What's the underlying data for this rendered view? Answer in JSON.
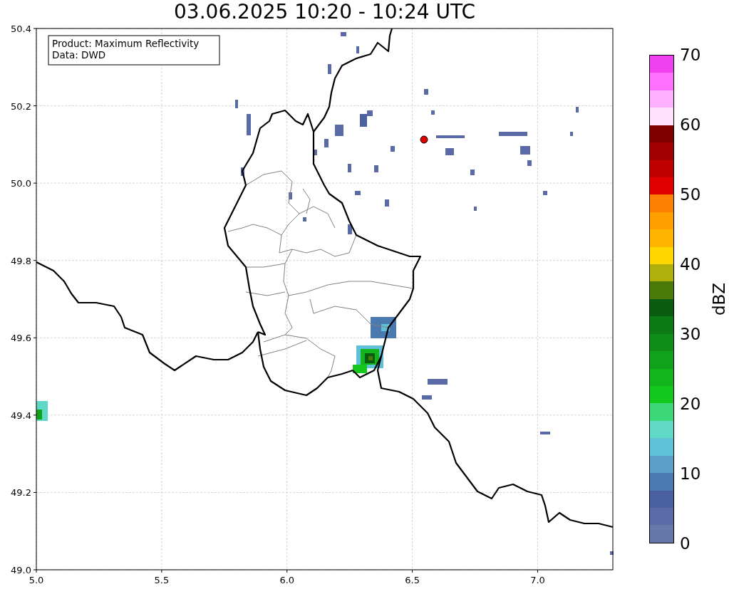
{
  "title": "03.06.2025 10:20 - 10:24 UTC",
  "map": {
    "info_lines": [
      "Product: Maximum Reflectivity",
      "Data: DWD"
    ],
    "xticks": [
      "5.0",
      "5.5",
      "6.0",
      "6.5",
      "7.0"
    ],
    "yticks": [
      "50.4",
      "50.2",
      "50.0",
      "49.8",
      "49.6",
      "49.4",
      "49.2",
      "49.0"
    ]
  },
  "colorbar": {
    "label": "dBZ",
    "ticks": [
      "70",
      "60",
      "50",
      "40",
      "30",
      "20",
      "10",
      "0"
    ],
    "bands": [
      {
        "color": "#6677aa"
      },
      {
        "color": "#5a6aa6"
      },
      {
        "color": "#4a60a0"
      },
      {
        "color": "#4a7ab0"
      },
      {
        "color": "#5aa0c8"
      },
      {
        "color": "#60c0d8"
      },
      {
        "color": "#60d8c8"
      },
      {
        "color": "#3cd878"
      },
      {
        "color": "#14c81e"
      },
      {
        "color": "#12b61c"
      },
      {
        "color": "#10a21a"
      },
      {
        "color": "#0e8e17"
      },
      {
        "color": "#0c7a15"
      },
      {
        "color": "#0a5a10"
      },
      {
        "color": "#4a7a0a"
      },
      {
        "color": "#b0b00a"
      },
      {
        "color": "#ffd700"
      },
      {
        "color": "#ffb400"
      },
      {
        "color": "#ffa000"
      },
      {
        "color": "#ff8000"
      },
      {
        "color": "#e00000"
      },
      {
        "color": "#c00000"
      },
      {
        "color": "#a00000"
      },
      {
        "color": "#800000"
      },
      {
        "color": "#ffe0ff"
      },
      {
        "color": "#ffb0ff"
      },
      {
        "color": "#ff70ff"
      },
      {
        "color": "#f040f0"
      }
    ]
  }
}
